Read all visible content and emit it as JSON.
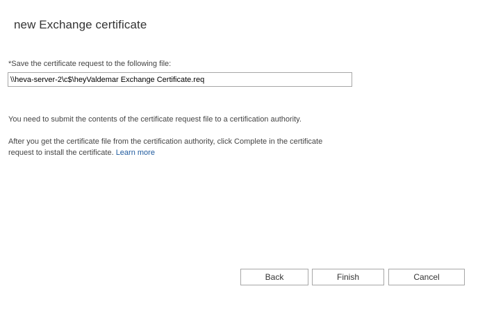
{
  "dialog": {
    "title": "new Exchange certificate"
  },
  "form": {
    "label": "*Save the certificate request to the following file:",
    "file_path": "\\\\heva-server-2\\c$\\heyValdemar Exchange Certificate.req"
  },
  "info": {
    "line1": "You need to submit the contents of the certificate request file to a certification authority.",
    "line2": "After you get the certificate file from the certification authority, click Complete in the certificate request to install the certificate.",
    "learn_more": "Learn more"
  },
  "buttons": {
    "back": "Back",
    "finish": "Finish",
    "cancel": "Cancel"
  }
}
